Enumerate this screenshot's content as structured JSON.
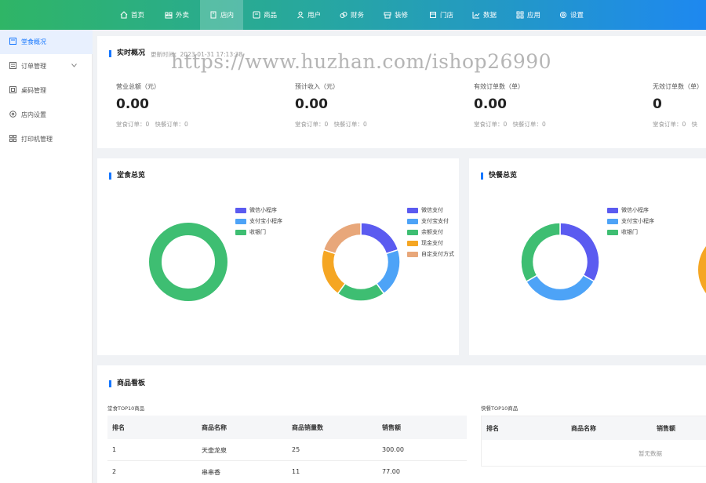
{
  "nav": {
    "items": [
      {
        "label": "首页",
        "icon": "home-icon"
      },
      {
        "label": "外卖",
        "icon": "delivery-icon"
      },
      {
        "label": "店内",
        "icon": "store-icon"
      },
      {
        "label": "商品",
        "icon": "goods-icon"
      },
      {
        "label": "用户",
        "icon": "user-icon"
      },
      {
        "label": "财务",
        "icon": "finance-icon"
      },
      {
        "label": "装修",
        "icon": "decor-icon"
      },
      {
        "label": "门店",
        "icon": "shop-icon"
      },
      {
        "label": "数据",
        "icon": "chart-icon"
      },
      {
        "label": "应用",
        "icon": "apps-icon"
      },
      {
        "label": "设置",
        "icon": "gear-icon"
      }
    ],
    "active_index": 2
  },
  "sidebar": {
    "items": [
      {
        "label": "堂食概况",
        "icon": "overview-icon"
      },
      {
        "label": "订单管理",
        "icon": "order-icon"
      },
      {
        "label": "桌码管理",
        "icon": "qrcode-icon"
      },
      {
        "label": "店内设置",
        "icon": "settings-icon"
      },
      {
        "label": "打印机管理",
        "icon": "printer-icon"
      }
    ],
    "active_index": 0
  },
  "realtime": {
    "title": "实时概况",
    "update_label": "更新时间：",
    "update_time": "2023-01-31 17:13:38",
    "stats": [
      {
        "label": "营业总额（元）",
        "value": "0.00",
        "sub1_label": "堂食订单：",
        "sub1_value": "0",
        "sub2_label": "快餐订单：",
        "sub2_value": "0"
      },
      {
        "label": "预计收入（元）",
        "value": "0.00",
        "sub1_label": "堂食订单：",
        "sub1_value": "0",
        "sub2_label": "快餐订单：",
        "sub2_value": "0"
      },
      {
        "label": "有效订单数（单）",
        "value": "0.00",
        "sub1_label": "堂食订单：",
        "sub1_value": "0",
        "sub2_label": "快餐订单：",
        "sub2_value": "0"
      },
      {
        "label": "无效订单数（单）",
        "value": "0",
        "sub1_label": "堂食订单：",
        "sub1_value": "0",
        "sub2_label": "快",
        "sub2_value": ""
      }
    ]
  },
  "dine_in": {
    "title": "堂食总览",
    "left_legend": [
      "微信小程序",
      "支付宝小程序",
      "收银门"
    ],
    "right_legend": [
      "微信支付",
      "支付宝支付",
      "余额支付",
      "现金支付",
      "自定支付方式"
    ]
  },
  "fast_food": {
    "title": "快餐总览",
    "legend": [
      "微信小程序",
      "支付宝小程序",
      "收银门"
    ]
  },
  "chart_data": [
    {
      "type": "pie",
      "donut": true,
      "categories": [
        "微信小程序",
        "支付宝小程序",
        "收银门"
      ],
      "values": [
        0,
        0,
        100
      ],
      "colors": [
        "#5b5bf0",
        "#4da3f7",
        "#3ebe72"
      ]
    },
    {
      "type": "pie",
      "donut": true,
      "categories": [
        "微信支付",
        "支付宝支付",
        "余额支付",
        "现金支付",
        "自定支付方式"
      ],
      "values": [
        20,
        20,
        20,
        20,
        20
      ],
      "colors": [
        "#5b5bf0",
        "#4da3f7",
        "#3ebe72",
        "#f5a623",
        "#e8a77a"
      ]
    },
    {
      "type": "pie",
      "donut": true,
      "categories": [
        "微信小程序",
        "支付宝小程序",
        "收银门"
      ],
      "values": [
        33.3,
        33.3,
        33.4
      ],
      "colors": [
        "#5b5bf0",
        "#4da3f7",
        "#3ebe72"
      ]
    }
  ],
  "goods_board": {
    "title": "商品看板",
    "dine_caption": "堂食TOP10商品",
    "dine_headers": [
      "排名",
      "商品名称",
      "商品销量数",
      "销售额"
    ],
    "dine_rows": [
      [
        "1",
        "天壶龙泉",
        "25",
        "300.00"
      ],
      [
        "2",
        "串串香",
        "11",
        "77.00"
      ]
    ],
    "fast_caption": "快餐TOP10商品",
    "fast_headers": [
      "排名",
      "商品名称",
      "销售额"
    ],
    "fast_empty": "暂无数据"
  },
  "watermark": "https://www.huzhan.com/ishop26990"
}
